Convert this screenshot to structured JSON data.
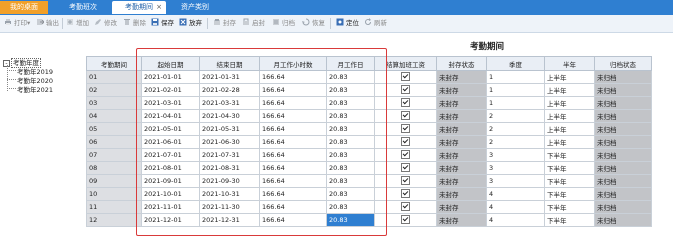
{
  "tabs": [
    {
      "label": "我的桌面"
    },
    {
      "label": "考勤班次"
    },
    {
      "label": "考勤期间",
      "close": "×"
    },
    {
      "label": "资产类别"
    }
  ],
  "toolbar": {
    "print": "打印",
    "export": "输出",
    "add": "增加",
    "edit": "修改",
    "delete": "删除",
    "save": "保存",
    "discard": "放弃",
    "seal": "封存",
    "unseal": "启封",
    "archive": "归档",
    "restore": "恢复",
    "locate": "定位",
    "refresh": "刷新",
    "dropdown": "▾"
  },
  "tree": {
    "expander": "-",
    "root": "考勤年度",
    "items": [
      "考勤年2019",
      "考勤年2020",
      "考勤年2021"
    ]
  },
  "title": "考勤期间",
  "columns": [
    "考勤期间",
    "起始日期",
    "结束日期",
    "月工作小时数",
    "月工作日",
    "结算加班工资",
    "封存状态",
    "季度",
    "半年",
    "归档状态"
  ],
  "rows": [
    {
      "period": "01",
      "start": "2021-01-01",
      "end": "2021-01-31",
      "hours": "166.64",
      "days": "20.83",
      "seal": "未封存",
      "quarter": "1",
      "half": "上半年",
      "archive": "未归档"
    },
    {
      "period": "02",
      "start": "2021-02-01",
      "end": "2021-02-28",
      "hours": "166.64",
      "days": "20.83",
      "seal": "未封存",
      "quarter": "1",
      "half": "上半年",
      "archive": "未归档"
    },
    {
      "period": "03",
      "start": "2021-03-01",
      "end": "2021-03-31",
      "hours": "166.64",
      "days": "20.83",
      "seal": "未封存",
      "quarter": "1",
      "half": "上半年",
      "archive": "未归档"
    },
    {
      "period": "04",
      "start": "2021-04-01",
      "end": "2021-04-30",
      "hours": "166.64",
      "days": "20.83",
      "seal": "未封存",
      "quarter": "2",
      "half": "上半年",
      "archive": "未归档"
    },
    {
      "period": "05",
      "start": "2021-05-01",
      "end": "2021-05-31",
      "hours": "166.64",
      "days": "20.83",
      "seal": "未封存",
      "quarter": "2",
      "half": "上半年",
      "archive": "未归档"
    },
    {
      "period": "06",
      "start": "2021-06-01",
      "end": "2021-06-30",
      "hours": "166.64",
      "days": "20.83",
      "seal": "未封存",
      "quarter": "2",
      "half": "上半年",
      "archive": "未归档"
    },
    {
      "period": "07",
      "start": "2021-07-01",
      "end": "2021-07-31",
      "hours": "166.64",
      "days": "20.83",
      "seal": "未封存",
      "quarter": "3",
      "half": "下半年",
      "archive": "未归档"
    },
    {
      "period": "08",
      "start": "2021-08-01",
      "end": "2021-08-31",
      "hours": "166.64",
      "days": "20.83",
      "seal": "未封存",
      "quarter": "3",
      "half": "下半年",
      "archive": "未归档"
    },
    {
      "period": "09",
      "start": "2021-09-01",
      "end": "2021-09-30",
      "hours": "166.64",
      "days": "20.83",
      "seal": "未封存",
      "quarter": "3",
      "half": "下半年",
      "archive": "未归档"
    },
    {
      "period": "10",
      "start": "2021-10-01",
      "end": "2021-10-31",
      "hours": "166.64",
      "days": "20.83",
      "seal": "未封存",
      "quarter": "4",
      "half": "下半年",
      "archive": "未归档"
    },
    {
      "period": "11",
      "start": "2021-11-01",
      "end": "2021-11-30",
      "hours": "166.64",
      "days": "20.83",
      "seal": "未封存",
      "quarter": "4",
      "half": "下半年",
      "archive": "未归档"
    },
    {
      "period": "12",
      "start": "2021-12-01",
      "end": "2021-12-31",
      "hours": "166.64",
      "days": "20.83",
      "seal": "未封存",
      "quarter": "4",
      "half": "下半年",
      "archive": "未归档"
    }
  ],
  "colors": {
    "accent": "#2f7fd1",
    "home_tab": "#f1a02a",
    "highlight": "#d93a3a",
    "selected_cell": "#2f7fd1"
  }
}
